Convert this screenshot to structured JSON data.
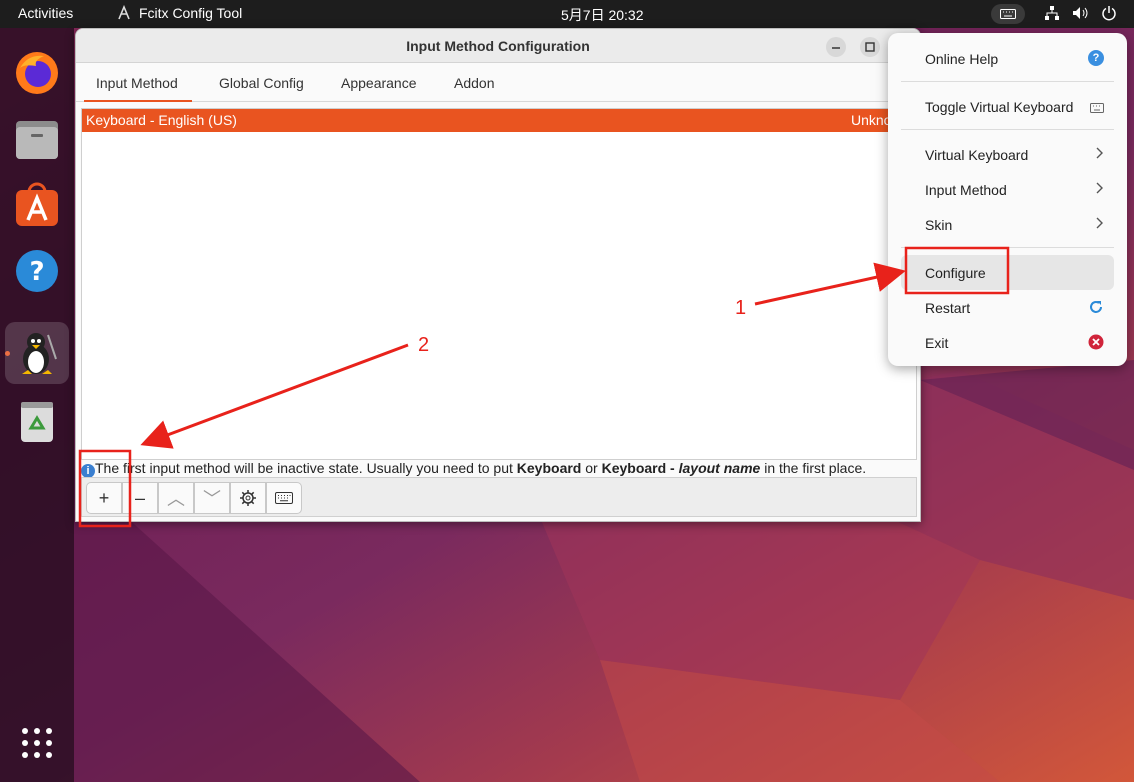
{
  "topbar": {
    "activities": "Activities",
    "app_name": "Fcitx Config Tool",
    "clock": "5月7日  20:32"
  },
  "window": {
    "title": "Input Method Configuration",
    "tabs": [
      {
        "label": "Input Method",
        "active": true
      },
      {
        "label": "Global Config",
        "active": false
      },
      {
        "label": "Appearance",
        "active": false
      },
      {
        "label": "Addon",
        "active": false
      }
    ],
    "list_rows": [
      {
        "name": "Keyboard - English (US)",
        "status": "Unkno"
      }
    ],
    "info": {
      "part1": "The first input method will be inactive state. Usually you need to put ",
      "bold1": "Keyboard",
      "part2": " or ",
      "bold2": "Keyboard - ",
      "italic": "layout name",
      "part3": " in the first place."
    },
    "buttons": {
      "add": "+",
      "remove": "–",
      "up": "︿",
      "down": "﹀"
    }
  },
  "menu": {
    "online_help": "Online Help",
    "toggle_vk": "Toggle Virtual Keyboard",
    "virtual_keyboard": "Virtual Keyboard",
    "input_method": "Input Method",
    "skin": "Skin",
    "configure": "Configure",
    "restart": "Restart",
    "exit": "Exit"
  },
  "annotations": {
    "label1": "1",
    "label2": "2",
    "color": "#e8221b"
  },
  "colors": {
    "accent": "#e95420",
    "annotation": "#e8221b"
  }
}
